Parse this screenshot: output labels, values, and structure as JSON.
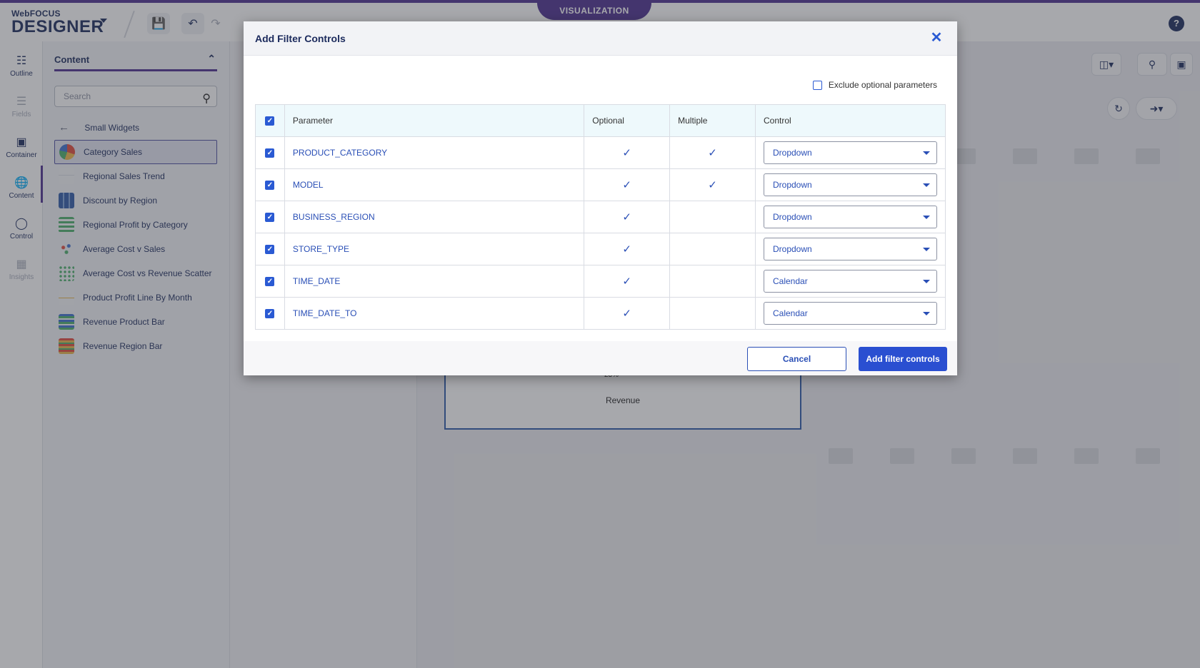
{
  "app": {
    "brand_small": "WebFOCUS",
    "brand_big": "DESIGNER",
    "mode_tab": "VISUALIZATION",
    "help_label": "?"
  },
  "rail": {
    "items": [
      {
        "label": "Outline",
        "icon": "outline-icon"
      },
      {
        "label": "Fields",
        "icon": "fields-icon"
      },
      {
        "label": "Container",
        "icon": "container-icon"
      },
      {
        "label": "Content",
        "icon": "globe-icon"
      },
      {
        "label": "Control",
        "icon": "toggle-icon"
      },
      {
        "label": "Insights",
        "icon": "insights-icon"
      }
    ]
  },
  "content_panel": {
    "title": "Content",
    "search_placeholder": "Search",
    "back_label": "Small Widgets",
    "widgets": [
      {
        "label": "Category Sales"
      },
      {
        "label": "Regional Sales Trend"
      },
      {
        "label": "Discount by Region"
      },
      {
        "label": "Regional Profit by Category"
      },
      {
        "label": "Average Cost v Sales"
      },
      {
        "label": "Average Cost vs Revenue Scatter"
      },
      {
        "label": "Product Profit Line By Month"
      },
      {
        "label": "Revenue Product Bar"
      },
      {
        "label": "Revenue Region Bar"
      }
    ]
  },
  "chart_preview": {
    "percent_label": "23%",
    "caption": "Revenue"
  },
  "dialog": {
    "title": "Add Filter Controls",
    "exclude_label": "Exclude optional parameters",
    "columns": {
      "parameter": "Parameter",
      "optional": "Optional",
      "multiple": "Multiple",
      "control": "Control"
    },
    "rows": [
      {
        "parameter": "PRODUCT_CATEGORY",
        "optional": true,
        "multiple": true,
        "control": "Dropdown"
      },
      {
        "parameter": "MODEL",
        "optional": true,
        "multiple": true,
        "control": "Dropdown"
      },
      {
        "parameter": "BUSINESS_REGION",
        "optional": true,
        "multiple": false,
        "control": "Dropdown"
      },
      {
        "parameter": "STORE_TYPE",
        "optional": true,
        "multiple": false,
        "control": "Dropdown"
      },
      {
        "parameter": "TIME_DATE",
        "optional": true,
        "multiple": false,
        "control": "Calendar"
      },
      {
        "parameter": "TIME_DATE_TO",
        "optional": true,
        "multiple": false,
        "control": "Calendar"
      }
    ],
    "cancel_label": "Cancel",
    "submit_label": "Add filter controls"
  },
  "colors": {
    "brand_purple": "#4b2f8f",
    "primary_blue": "#2a4fd1",
    "navy": "#1b2a5c"
  }
}
